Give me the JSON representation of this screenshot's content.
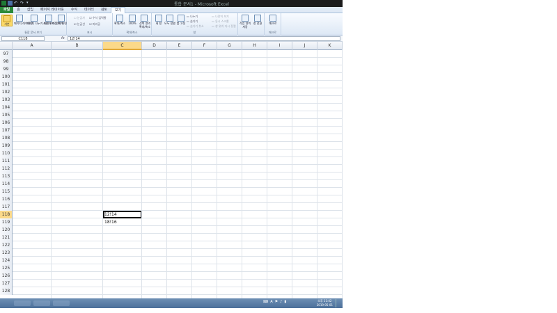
{
  "window": {
    "title": "통합 문서1 - Microsoft Excel"
  },
  "ribbon": {
    "tabs": [
      {
        "label": "파일",
        "kind": "file"
      },
      {
        "label": "홈",
        "kind": ""
      },
      {
        "label": "삽입",
        "kind": ""
      },
      {
        "label": "페이지 레이아웃",
        "kind": ""
      },
      {
        "label": "수식",
        "kind": ""
      },
      {
        "label": "데이터",
        "kind": ""
      },
      {
        "label": "검토",
        "kind": ""
      },
      {
        "label": "보기",
        "kind": "active"
      }
    ],
    "groups": {
      "workbook_views": {
        "label": "통합 문서 보기",
        "normal": "기본",
        "page_layout": "페이지 레이아웃",
        "page_break": "페이지 나누기 미리 보기",
        "custom_views": "사용자 지정 보기",
        "full_screen": "전체 화면"
      },
      "show": {
        "label": "표시",
        "ruler": "눈금자",
        "formula_bar": "수식 입력줄",
        "gridlines": "눈금선",
        "headings": "머리글"
      },
      "zoom": {
        "label": "확대/축소",
        "zoom": "확대/축소",
        "zoom100": "100%",
        "zoom_selection": "선택 영역 확대/축소"
      },
      "window": {
        "label": "창",
        "new_window": "새 창",
        "arrange_all": "모두 정렬",
        "freeze_panes": "틀 고정",
        "split": "나누기",
        "hide": "숨기기",
        "unhide": "숨기기 취소",
        "side_by_side": "나란히 보기",
        "sync_scroll": "동시 스크롤",
        "reset_position": "창 위치 다시 정렬",
        "save_workspace": "작업 영역 저장",
        "switch_windows": "창 전환"
      },
      "macros": {
        "label": "매크로",
        "macros": "매크로"
      }
    }
  },
  "formula_bar": {
    "name_box": "C118",
    "fx": "fx",
    "value": "12!14"
  },
  "grid": {
    "columns": [
      "A",
      "B",
      "C",
      "D",
      "E",
      "F",
      "G",
      "H",
      "I",
      "J",
      "K"
    ],
    "active_column": "C",
    "rows": [
      "97",
      "98",
      "99",
      "100",
      "101",
      "102",
      "103",
      "104",
      "105",
      "106",
      "107",
      "108",
      "109",
      "110",
      "111",
      "112",
      "113",
      "114",
      "115",
      "116",
      "117",
      "118",
      "119",
      "120",
      "121",
      "122",
      "123",
      "124",
      "125",
      "126",
      "127",
      "128"
    ],
    "active_row": "118",
    "cells": [
      {
        "row": "118",
        "col": "C",
        "value": "12!14",
        "selected": true
      },
      {
        "row": "119",
        "col": "C",
        "value": "18!16",
        "selected": false
      }
    ]
  },
  "taskbar": {
    "clock_time": "오후 11:42",
    "clock_date": "2019-05-01",
    "tray_icons": [
      "keyboard-icon",
      "language-a-icon",
      "flag-icon",
      "volume-icon",
      "network-icon"
    ]
  }
}
